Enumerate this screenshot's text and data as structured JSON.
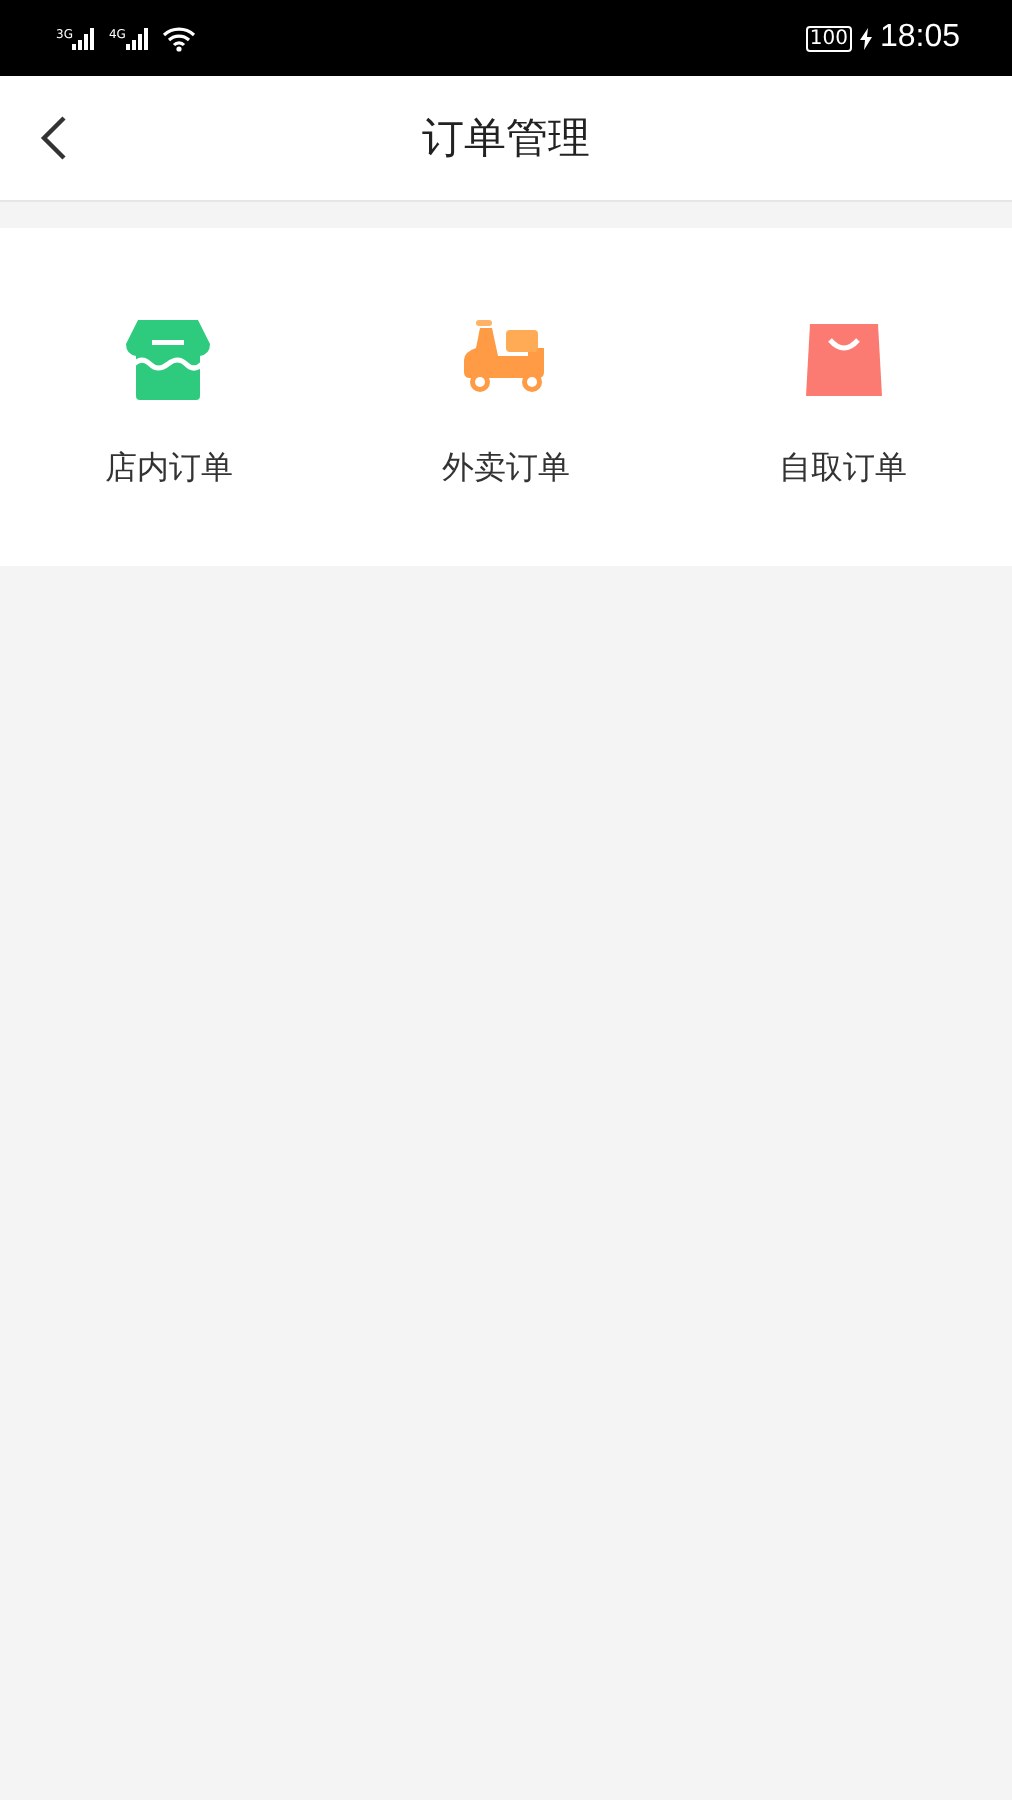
{
  "status_bar": {
    "networks": [
      "3G",
      "4G"
    ],
    "battery": "100",
    "time": "18:05"
  },
  "header": {
    "title": "订单管理"
  },
  "order_types": [
    {
      "kind": "store",
      "label": "店内订单"
    },
    {
      "kind": "scooter",
      "label": "外卖订单"
    },
    {
      "kind": "bag",
      "label": "自取订单"
    }
  ]
}
